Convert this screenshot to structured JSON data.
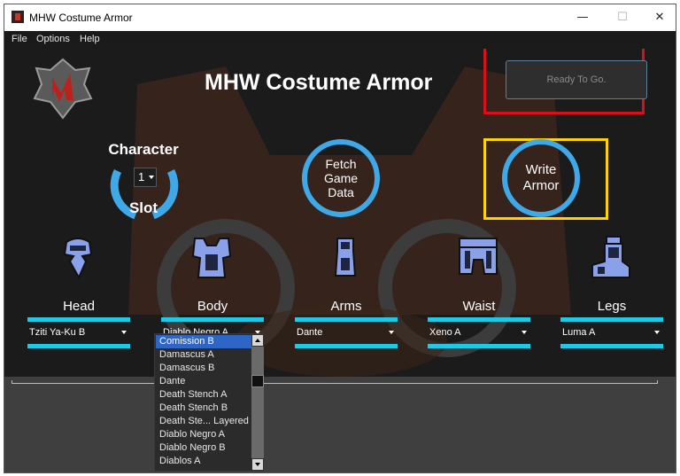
{
  "window": {
    "title": "MHW Costume Armor",
    "minimize": "—",
    "maximize": "☐",
    "close": "✕"
  },
  "menu": [
    {
      "label": "File"
    },
    {
      "label": "Options"
    },
    {
      "label": "Help"
    }
  ],
  "header": {
    "app_title": "MHW Costume Armor",
    "status": "Ready To Go."
  },
  "character": {
    "label": "Character",
    "slot_label": "Slot",
    "value": "1"
  },
  "buttons": {
    "fetch": "Fetch\nGame\nData",
    "write": "Write\nArmor"
  },
  "slots": [
    {
      "name": "Head",
      "value": "Tziti Ya-Ku B"
    },
    {
      "name": "Body",
      "value": "Diablo Negro A"
    },
    {
      "name": "Arms",
      "value": "Dante"
    },
    {
      "name": "Waist",
      "value": "Xeno A"
    },
    {
      "name": "Legs",
      "value": "Luma A"
    }
  ],
  "body_options": [
    "Comission B",
    "Damascus A",
    "Damascus B",
    "Dante",
    "Death Stench A",
    "Death Stench B",
    "Death Ste... Layered",
    "Diablo Negro A",
    "Diablo Negro B",
    "Diablos A"
  ],
  "colors": {
    "accent_blue": "#3fa9e8",
    "cyan_bar": "#1ec9e6",
    "highlight_red": "#d9101c",
    "highlight_yellow": "#ffd400",
    "selection": "#2d66c7"
  }
}
